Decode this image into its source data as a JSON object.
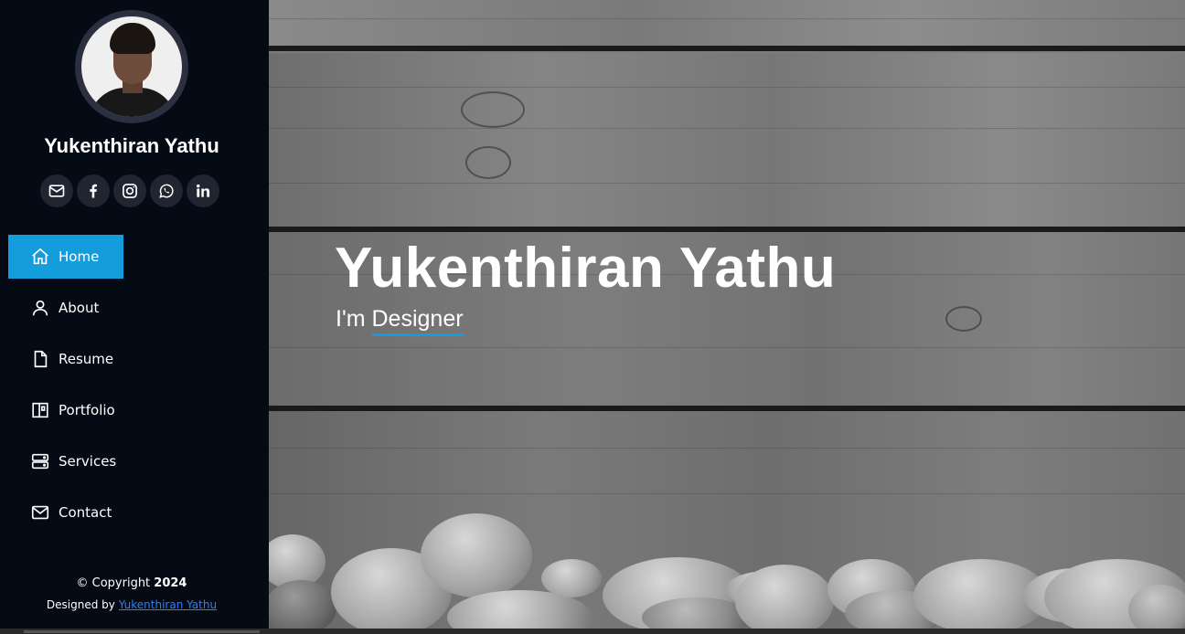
{
  "profile": {
    "name": "Yukenthiran Yathu",
    "avatar_alt": "profile-photo"
  },
  "socials": [
    {
      "name": "email-icon"
    },
    {
      "name": "facebook-icon"
    },
    {
      "name": "instagram-icon"
    },
    {
      "name": "whatsapp-icon"
    },
    {
      "name": "linkedin-icon"
    }
  ],
  "nav": {
    "items": [
      {
        "label": "Home",
        "icon": "home-icon",
        "active": true
      },
      {
        "label": "About",
        "icon": "user-icon"
      },
      {
        "label": "Resume",
        "icon": "file-icon"
      },
      {
        "label": "Portfolio",
        "icon": "portfolio-icon"
      },
      {
        "label": "Services",
        "icon": "server-icon"
      },
      {
        "label": "Contact",
        "icon": "envelope-icon"
      }
    ]
  },
  "footer": {
    "copyright_prefix": "© Copyright",
    "year": "2024",
    "designed_by_prefix": "Designed by",
    "designer": "Yukenthiran Yathu"
  },
  "hero": {
    "title": "Yukenthiran Yathu",
    "sub_prefix": "I'm",
    "typed": "Designer"
  },
  "colors": {
    "accent": "#149ddd",
    "sidebar_bg": "#040b14",
    "social_bg": "#212431",
    "link": "#2f7dff"
  }
}
